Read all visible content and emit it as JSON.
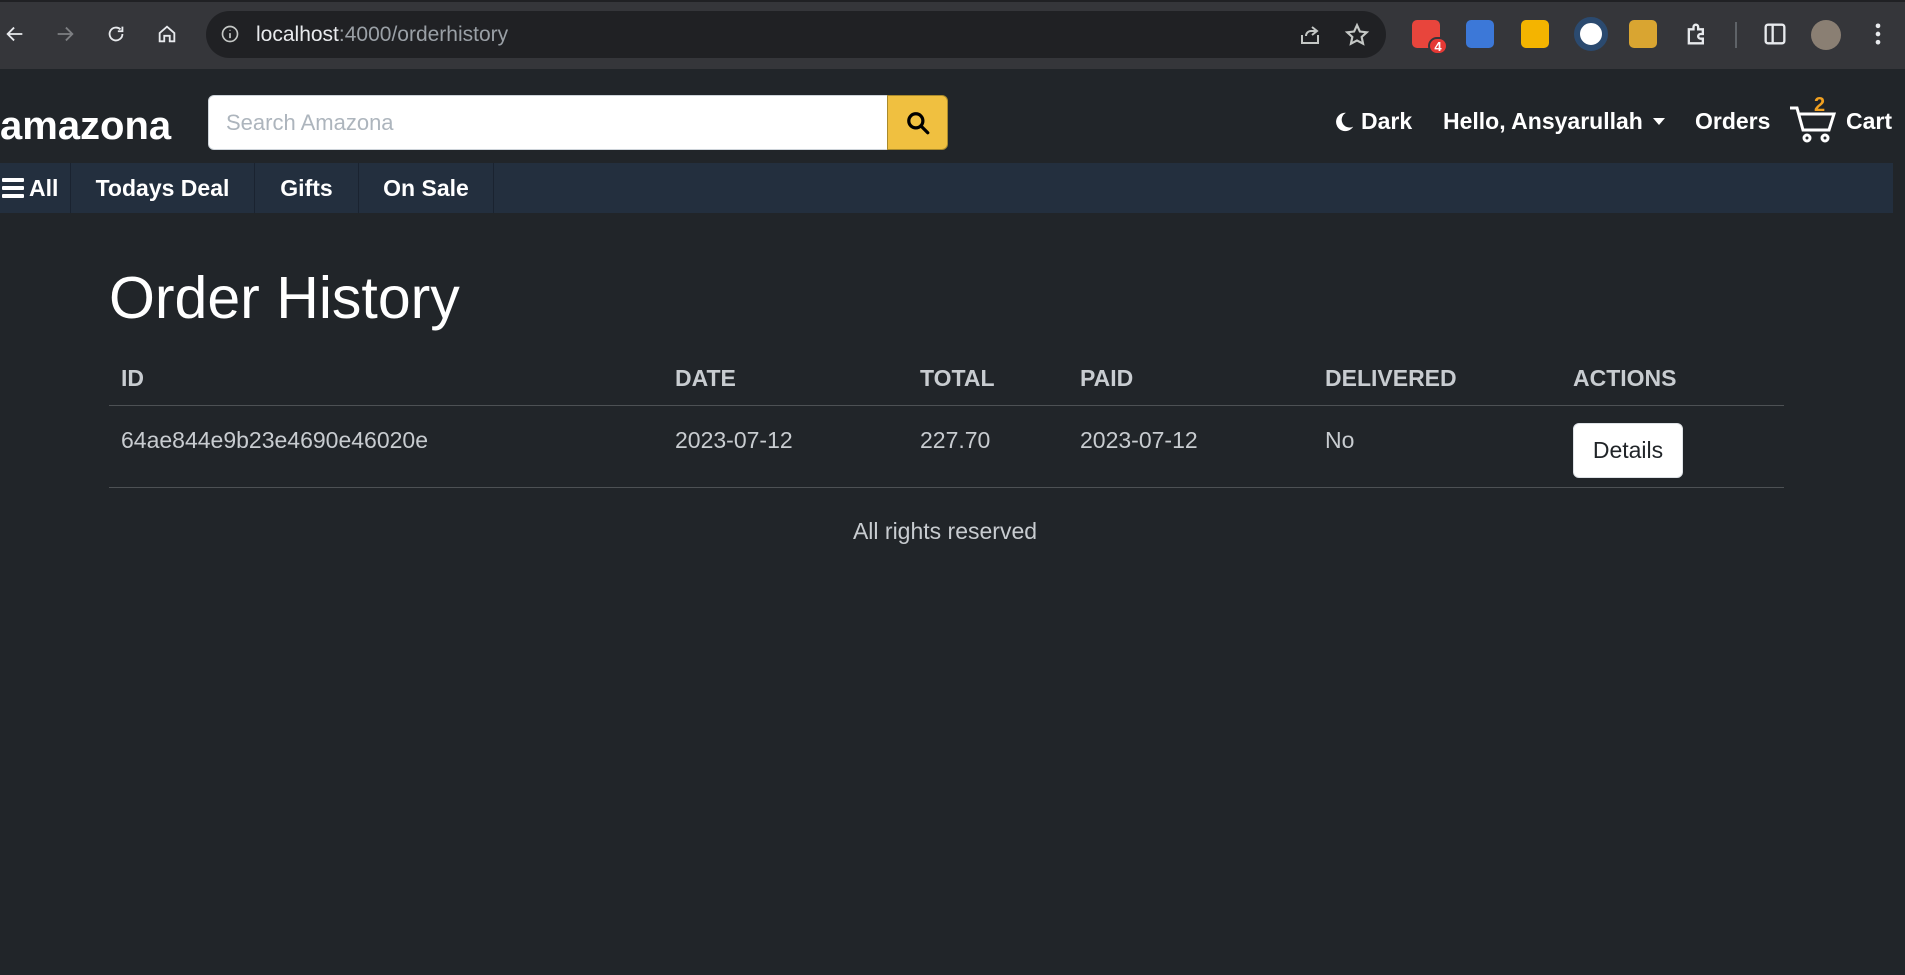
{
  "browser": {
    "url_host": "localhost",
    "url_path": ":4000/orderhistory",
    "extension_badge": "4"
  },
  "header": {
    "brand": "amazona",
    "search_placeholder": "Search Amazona",
    "theme_label": "Dark",
    "user_label": "Hello, Ansyarullah",
    "orders_label": "Orders",
    "cart_label": "Cart",
    "cart_count": "2",
    "colors": {
      "search_button": "#f0c040",
      "cart_count": "#f0a020",
      "subnav_bg": "#232f3e"
    }
  },
  "subnav": {
    "all_label": "All",
    "items": [
      {
        "label": "Todays Deal"
      },
      {
        "label": "Gifts"
      },
      {
        "label": "On Sale"
      }
    ]
  },
  "main": {
    "title": "Order History",
    "columns": [
      "ID",
      "DATE",
      "TOTAL",
      "PAID",
      "DELIVERED",
      "ACTIONS"
    ],
    "rows": [
      {
        "id": "64ae844e9b23e4690e46020e",
        "date": "2023-07-12",
        "total": "227.70",
        "paid": "2023-07-12",
        "delivered": "No",
        "action_label": "Details"
      }
    ]
  },
  "footer": {
    "text": "All rights reserved"
  }
}
